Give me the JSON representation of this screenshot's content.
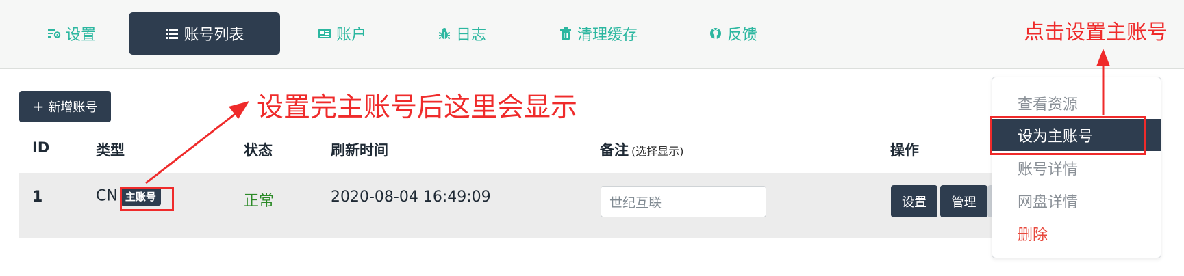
{
  "nav": {
    "tabs": [
      {
        "label": "设置",
        "icon": "settings-icon"
      },
      {
        "label": "账号列表",
        "icon": "list-icon"
      },
      {
        "label": "账户",
        "icon": "id-card-icon"
      },
      {
        "label": "日志",
        "icon": "bug-icon"
      },
      {
        "label": "清理缓存",
        "icon": "trash-icon"
      },
      {
        "label": "反馈",
        "icon": "github-icon"
      }
    ],
    "active_tab": "账号列表"
  },
  "toolbar": {
    "add_plus": "+",
    "add_label": "新增账号"
  },
  "table": {
    "headers": {
      "id": "ID",
      "type": "类型",
      "status": "状态",
      "refresh": "刷新时间",
      "remark": "备注",
      "remark_hint": "(选择显示)",
      "ops": "操作"
    },
    "rows": [
      {
        "id": "1",
        "type": "CN",
        "badge": "主账号",
        "status": "正常",
        "refresh_time": "2020-08-04 16:49:09",
        "remark_value": "世纪互联",
        "btn_settings": "设置",
        "btn_manage": "管理"
      }
    ]
  },
  "dropdown": {
    "items": [
      {
        "label": "查看资源"
      },
      {
        "label": "设为主账号",
        "active": true
      },
      {
        "label": "账号详情"
      },
      {
        "label": "网盘详情"
      },
      {
        "label": "删除",
        "danger": true
      }
    ]
  },
  "annotations": {
    "top_right": "点击设置主账号",
    "middle": "设置完主账号后这里会显示"
  },
  "colors": {
    "accent": "#2cb7a0",
    "dark": "#2e3d4f",
    "annotation": "#ef2b2b",
    "status_ok": "#2c8a28",
    "danger": "#e8493d"
  }
}
